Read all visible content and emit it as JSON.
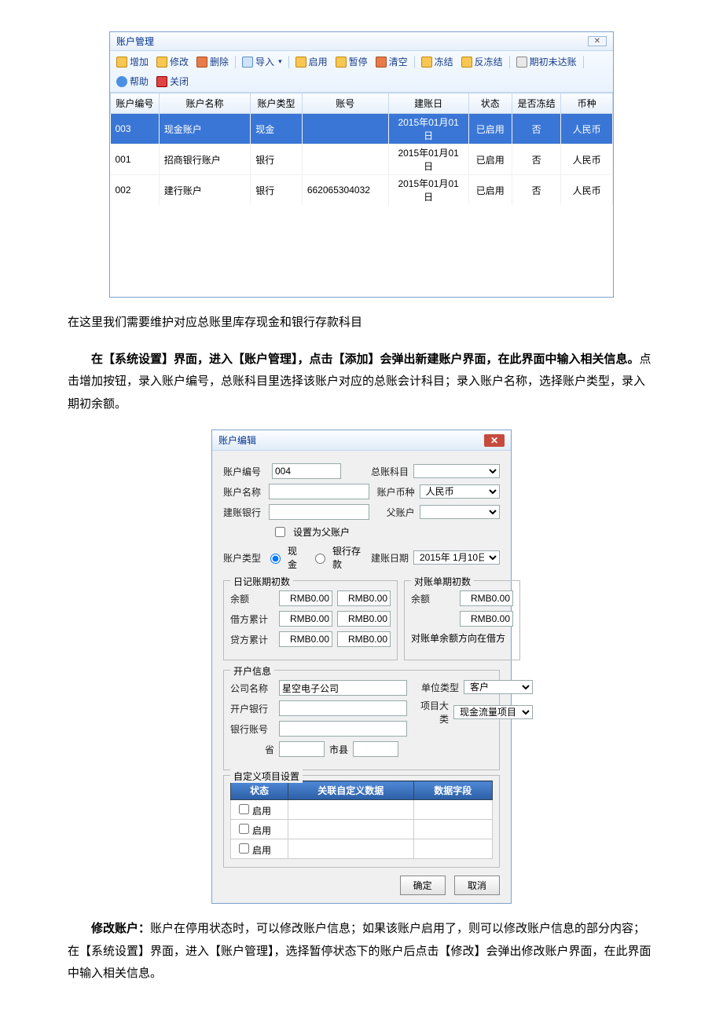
{
  "mgmt": {
    "title": "账户管理",
    "close_x": "✕",
    "toolbar": {
      "add": "增加",
      "edit": "修改",
      "delete": "删除",
      "import": "导入",
      "enable": "启用",
      "pause": "暂停",
      "clear": "清空",
      "freeze": "冻结",
      "unfreeze": "反冻结",
      "initUnreached": "期初未达账",
      "help": "帮助",
      "close": "关闭",
      "dot": "▾"
    },
    "cols": {
      "code": "账户编号",
      "name": "账户名称",
      "type": "账户类型",
      "acctno": "账号",
      "date": "建账日",
      "status": "状态",
      "frozen": "是否冻结",
      "currency": "币种"
    },
    "rows": [
      {
        "code": "003",
        "name": "现金账户",
        "type": "现金",
        "acctno": "",
        "date": "2015年01月01日",
        "status": "已启用",
        "frozen": "否",
        "currency": "人民币",
        "sel": true
      },
      {
        "code": "001",
        "name": "招商银行账户",
        "type": "银行",
        "acctno": "",
        "date": "2015年01月01日",
        "status": "已启用",
        "frozen": "否",
        "currency": "人民币",
        "sel": false
      },
      {
        "code": "002",
        "name": "建行账户",
        "type": "银行",
        "acctno": "662065304032",
        "date": "2015年01月01日",
        "status": "已启用",
        "frozen": "否",
        "currency": "人民币",
        "sel": false
      }
    ]
  },
  "para1": "在这里我们需要维护对应总账里库存现金和银行存款科目",
  "para2": {
    "bold": "在【系统设置】界面，进入【账户管理】，点击【添加】会弹出新建账户界面，在此界面中输入相关信息。",
    "rest": "点击增加按钮，录入账户编号，总账科目里选择该账户对应的总账会计科目；录入账户名称，选择账户类型，录入期初余额。"
  },
  "dlg": {
    "title": "账户编辑",
    "labels": {
      "code": "账户编号",
      "subject": "总账科目",
      "name": "账户名称",
      "currency": "账户币种",
      "bank": "建账银行",
      "parent": "父账户",
      "asParent": "设置为父账户",
      "type": "账户类型",
      "cash": "现金",
      "deposit": "银行存款",
      "date": "建账日期",
      "journal": "日记账期初数",
      "recon": "对账单期初数",
      "balance": "余额",
      "debit": "借方累计",
      "credit": "贷方累计",
      "reconSide": "对账单余额方向在借方",
      "open": "开户信息",
      "company": "公司名称",
      "openBank": "开户银行",
      "bankAcct": "银行账号",
      "province": "省",
      "city": "市县",
      "unitType": "单位类型",
      "projCat": "项目大类",
      "custom": "自定义项目设置",
      "status": "状态",
      "link": "关联自定义数据",
      "field": "数据字段",
      "enableRow": "启用",
      "ok": "确定",
      "cancel": "取消"
    },
    "values": {
      "code": "004",
      "currency": "人民币",
      "date": "2015年 1月10日",
      "rmb0": "RMB0.00",
      "company": "星空电子公司",
      "unitType": "客户",
      "projCat": "现金流量项目"
    }
  },
  "para3": {
    "bold": "修改账户：",
    "rest": "账户在停用状态时，可以修改账户信息；如果该账户启用了，则可以修改账户信息的部分内容；在【系统设置】界面，进入【账户管理】，选择暂停状态下的账户后点击【修改】会弹出修改账户界面，在此界面中输入相关信息。"
  }
}
